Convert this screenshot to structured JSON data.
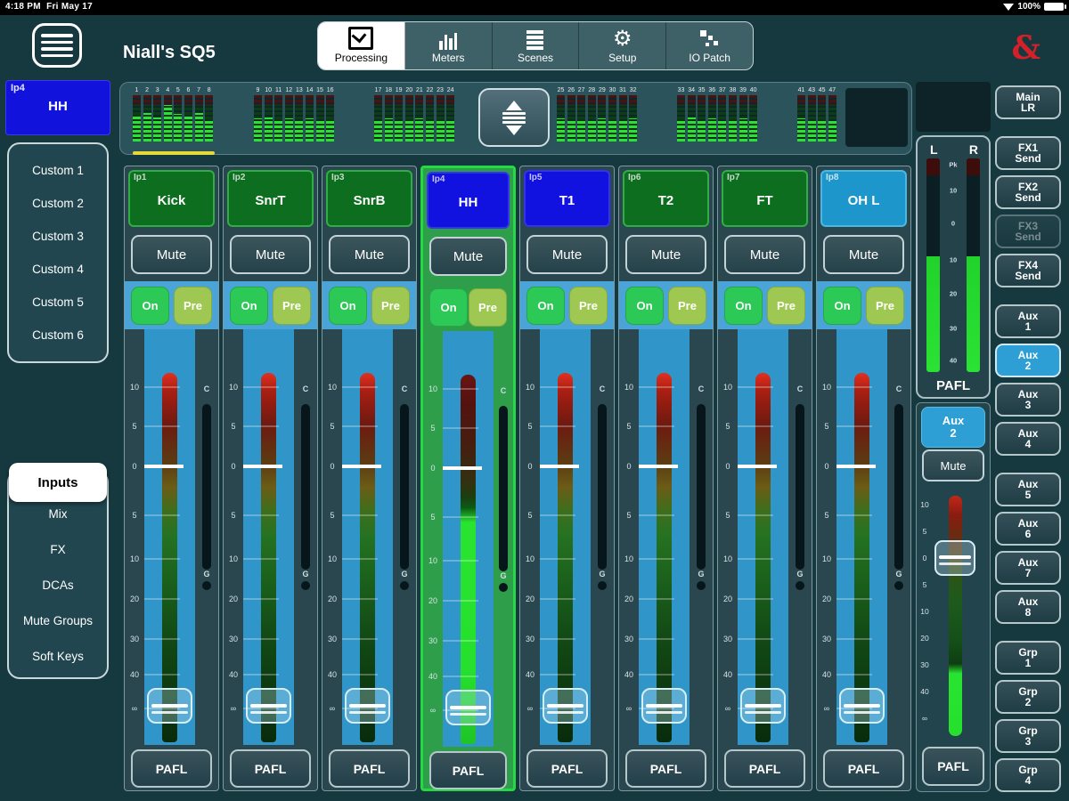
{
  "status_bar": {
    "time": "4:18 PM",
    "date": "Fri May 17",
    "battery": "100%"
  },
  "header": {
    "title": "Niall's SQ5",
    "logo": "&",
    "logo_color": "#d42129",
    "tabs": [
      {
        "label": "Processing",
        "icon": "processing-icon",
        "selected": true
      },
      {
        "label": "Meters",
        "icon": "meters-icon",
        "selected": false
      },
      {
        "label": "Scenes",
        "icon": "scenes-icon",
        "selected": false
      },
      {
        "label": "Setup",
        "icon": "gear-icon",
        "selected": false
      },
      {
        "label": "IO Patch",
        "icon": "io-patch-icon",
        "selected": false
      }
    ]
  },
  "sidebar": {
    "channel_badge": {
      "id": "Ip4",
      "name": "HH"
    },
    "custom_layers": [
      "Custom 1",
      "Custom 2",
      "Custom 3",
      "Custom 4",
      "Custom 5",
      "Custom 6"
    ],
    "nav": [
      {
        "label": "Inputs",
        "selected": true
      },
      {
        "label": "Mix",
        "selected": false
      },
      {
        "label": "FX",
        "selected": false
      },
      {
        "label": "DCAs",
        "selected": false
      },
      {
        "label": "Mute Groups",
        "selected": false
      },
      {
        "label": "Soft Keys",
        "selected": false
      }
    ]
  },
  "meter_bridge": {
    "groups": [
      {
        "labels": [
          "1",
          "2",
          "3",
          "4",
          "5",
          "6",
          "7",
          "8"
        ],
        "levels": [
          58,
          62,
          52,
          78,
          60,
          54,
          62,
          48
        ],
        "active": true
      },
      {
        "labels": [
          "9",
          "10",
          "11",
          "12",
          "13",
          "14",
          "15",
          "16"
        ],
        "levels": [
          50,
          52,
          48,
          50,
          46,
          50,
          44,
          48
        ],
        "active": false
      },
      {
        "labels": [
          "17",
          "18",
          "19",
          "20",
          "21",
          "22",
          "23",
          "24"
        ],
        "levels": [
          46,
          50,
          44,
          48,
          50,
          46,
          48,
          44
        ],
        "active": false
      },
      {
        "labels": [
          "25",
          "26",
          "27",
          "28",
          "29",
          "30",
          "31",
          "32"
        ],
        "levels": [
          50,
          46,
          48,
          44,
          50,
          48,
          46,
          50
        ],
        "active": false
      },
      {
        "labels": [
          "33",
          "34",
          "35",
          "36",
          "37",
          "38",
          "39",
          "40"
        ],
        "levels": [
          48,
          52,
          46,
          50,
          44,
          48,
          50,
          46
        ],
        "active": false
      },
      {
        "labels": [
          "41",
          "43",
          "45",
          "47"
        ],
        "levels": [
          50,
          46,
          48,
          44
        ],
        "active": false
      }
    ],
    "active_bank_underline_color": "#e8d83a"
  },
  "strip_labels": {
    "mute": "Mute",
    "on": "On",
    "pre": "Pre",
    "pafl": "PAFL",
    "comp": "C",
    "gate": "G"
  },
  "fader_scale": [
    "10",
    "5",
    "0",
    "5",
    "10",
    "20",
    "30",
    "40",
    "∞"
  ],
  "channels": [
    {
      "id": "Ip1",
      "name": "Kick",
      "color": "green",
      "selected": false
    },
    {
      "id": "Ip2",
      "name": "SnrT",
      "color": "green",
      "selected": false
    },
    {
      "id": "Ip3",
      "name": "SnrB",
      "color": "green",
      "selected": false
    },
    {
      "id": "Ip4",
      "name": "HH",
      "color": "blue",
      "selected": true
    },
    {
      "id": "Ip5",
      "name": "T1",
      "color": "blue",
      "selected": false
    },
    {
      "id": "Ip6",
      "name": "T2",
      "color": "green",
      "selected": false
    },
    {
      "id": "Ip7",
      "name": "FT",
      "color": "green",
      "selected": false
    },
    {
      "id": "Ip8",
      "name": "OH L",
      "color": "cyan",
      "selected": false
    }
  ],
  "main_meter": {
    "left": "L",
    "right": "R",
    "scale": [
      "Pk",
      "10",
      "0",
      "10",
      "20",
      "30",
      "40"
    ],
    "pafl": "PAFL"
  },
  "aux_master": {
    "line1": "Aux",
    "line2": "2",
    "mute": "Mute",
    "pafl": "PAFL"
  },
  "mix_buttons": [
    {
      "lines": [
        "Main",
        "LR"
      ],
      "selected": false,
      "disabled": false,
      "gap_after": true
    },
    {
      "lines": [
        "FX1",
        "Send"
      ],
      "selected": false,
      "disabled": false,
      "gap_after": false
    },
    {
      "lines": [
        "FX2",
        "Send"
      ],
      "selected": false,
      "disabled": false,
      "gap_after": false
    },
    {
      "lines": [
        "FX3",
        "Send"
      ],
      "selected": false,
      "disabled": true,
      "gap_after": false
    },
    {
      "lines": [
        "FX4",
        "Send"
      ],
      "selected": false,
      "disabled": false,
      "gap_after": true
    },
    {
      "lines": [
        "Aux",
        "1"
      ],
      "selected": false,
      "disabled": false,
      "gap_after": false
    },
    {
      "lines": [
        "Aux",
        "2"
      ],
      "selected": true,
      "disabled": false,
      "gap_after": false
    },
    {
      "lines": [
        "Aux",
        "3"
      ],
      "selected": false,
      "disabled": false,
      "gap_after": false
    },
    {
      "lines": [
        "Aux",
        "4"
      ],
      "selected": false,
      "disabled": false,
      "gap_after": true
    },
    {
      "lines": [
        "Aux",
        "5"
      ],
      "selected": false,
      "disabled": false,
      "gap_after": false
    },
    {
      "lines": [
        "Aux",
        "6"
      ],
      "selected": false,
      "disabled": false,
      "gap_after": false
    },
    {
      "lines": [
        "Aux",
        "7"
      ],
      "selected": false,
      "disabled": false,
      "gap_after": false
    },
    {
      "lines": [
        "Aux",
        "8"
      ],
      "selected": false,
      "disabled": false,
      "gap_after": true
    },
    {
      "lines": [
        "Grp",
        "1"
      ],
      "selected": false,
      "disabled": false,
      "gap_after": false
    },
    {
      "lines": [
        "Grp",
        "2"
      ],
      "selected": false,
      "disabled": false,
      "gap_after": false
    },
    {
      "lines": [
        "Grp",
        "3"
      ],
      "selected": false,
      "disabled": false,
      "gap_after": false
    },
    {
      "lines": [
        "Grp",
        "4"
      ],
      "selected": false,
      "disabled": false,
      "gap_after": false
    }
  ],
  "colors": {
    "accent_blue": "#2e9fd4",
    "selected_green": "#27d845",
    "name_green": "#0e6e1f",
    "name_blue": "#1111e0",
    "name_cyan": "#1d96cc",
    "meter_green": "#2ae234"
  }
}
